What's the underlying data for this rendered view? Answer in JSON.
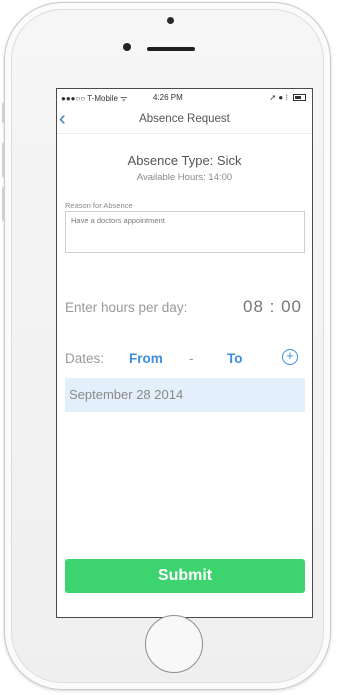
{
  "status_bar": {
    "carrier": "●●●○○ T-Mobile ᯤ",
    "time": "4:26 PM",
    "icons": "➚ ● ⁝"
  },
  "nav": {
    "back_icon": "chevron-left-icon",
    "title": "Absence Request"
  },
  "absence": {
    "type": "Absence Type: Sick",
    "available": "Available Hours: 14:00"
  },
  "reason": {
    "label": "Reason for Absence",
    "value": "Have a doctors appointment"
  },
  "hours": {
    "label": "Enter hours per day:",
    "value": "08 : 00"
  },
  "dates": {
    "label": "Dates:",
    "from": "From",
    "separator": "-",
    "to": "To",
    "add_icon": "plus-circle-icon",
    "selected": "September 28 2014"
  },
  "submit": {
    "label": "Submit"
  },
  "colors": {
    "accent": "#3a8fe0",
    "submit_bg": "#3dd46f",
    "date_row_bg": "#e3effa"
  }
}
